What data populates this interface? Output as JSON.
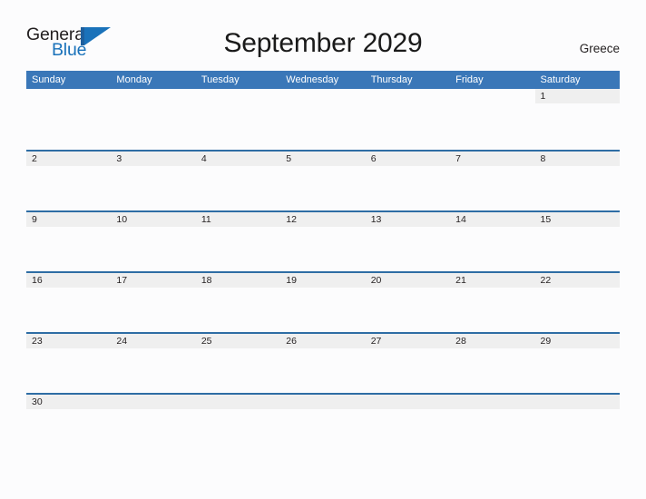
{
  "brand": {
    "name_part1": "General",
    "name_part2": "Blue",
    "flag_icon": "flag-triangle-icon",
    "color_dark": "#231f20",
    "color_blue": "#1a72ba"
  },
  "header": {
    "title": "September 2029",
    "month": "September",
    "year": "2029",
    "country": "Greece"
  },
  "theme": {
    "header_blue": "#3a77b8",
    "row_rule_blue": "#2e6da4",
    "day_band_grey": "#efefef",
    "page_background": "#fcfcfd",
    "text_dark": "#231f20"
  },
  "calendar": {
    "weekdays": [
      "Sunday",
      "Monday",
      "Tuesday",
      "Wednesday",
      "Thursday",
      "Friday",
      "Saturday"
    ],
    "weeks": [
      [
        "",
        "",
        "",
        "",
        "",
        "",
        "1"
      ],
      [
        "2",
        "3",
        "4",
        "5",
        "6",
        "7",
        "8"
      ],
      [
        "9",
        "10",
        "11",
        "12",
        "13",
        "14",
        "15"
      ],
      [
        "16",
        "17",
        "18",
        "19",
        "20",
        "21",
        "22"
      ],
      [
        "23",
        "24",
        "25",
        "26",
        "27",
        "28",
        "29"
      ],
      [
        "30",
        "",
        "",
        "",
        "",
        "",
        ""
      ]
    ]
  }
}
